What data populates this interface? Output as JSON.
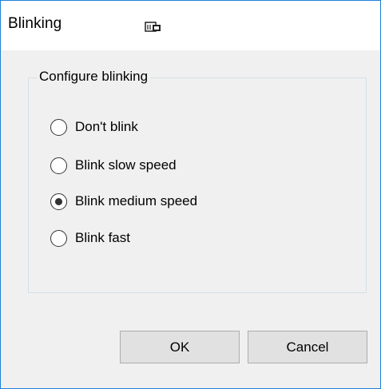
{
  "window": {
    "title": "Blinking",
    "title_icon": "window-icon"
  },
  "group": {
    "legend": "Configure blinking",
    "options": [
      {
        "label": "Don't blink",
        "checked": false
      },
      {
        "label": "Blink slow speed",
        "checked": false
      },
      {
        "label": "Blink medium speed",
        "checked": true
      },
      {
        "label": "Blink fast",
        "checked": false
      }
    ]
  },
  "buttons": {
    "ok_label": "OK",
    "cancel_label": "Cancel"
  },
  "colors": {
    "window_border": "#1e7fd8",
    "dialog_background": "#f0f0f0",
    "button_background": "#e1e1e1"
  }
}
